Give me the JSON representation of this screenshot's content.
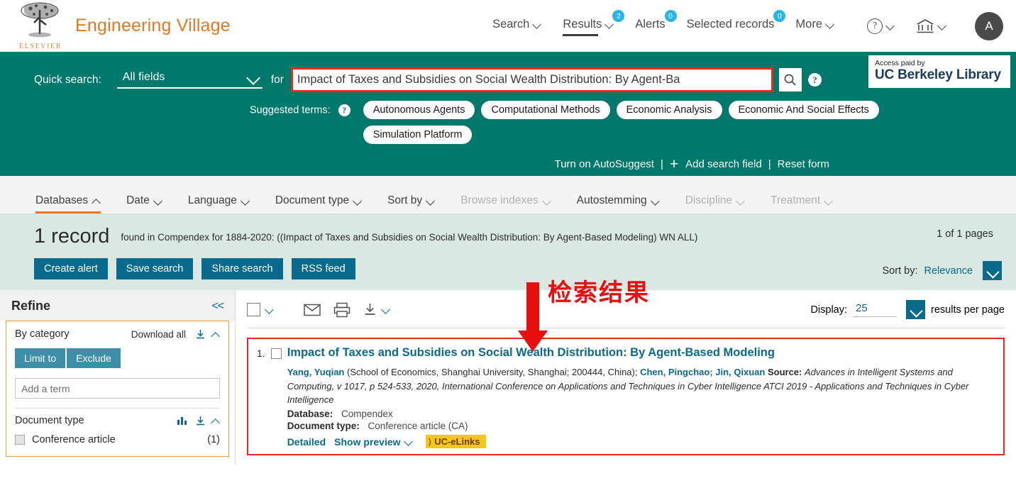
{
  "header": {
    "brand_name": "Engineering Village",
    "publisher": "ELSEVIER",
    "nav": [
      {
        "label": "Search",
        "chevron": true,
        "badge": null,
        "active": false
      },
      {
        "label": "Results",
        "chevron": true,
        "badge": "2",
        "active": true
      },
      {
        "label": "Alerts",
        "chevron": false,
        "badge": "0",
        "active": false
      },
      {
        "label": "Selected records",
        "chevron": false,
        "badge": "0",
        "active": false
      },
      {
        "label": "More",
        "chevron": true,
        "badge": null,
        "active": false
      }
    ],
    "avatar_initial": "A"
  },
  "search": {
    "quick_search_label": "Quick search:",
    "field_value": "All fields",
    "for_label": "for",
    "query": "Impact of Taxes and Subsidies on Social Wealth Distribution: By Agent-Ba",
    "suggested_label": "Suggested terms:",
    "suggested_terms": [
      "Autonomous Agents",
      "Computational Methods",
      "Economic Analysis",
      "Economic And Social Effects",
      "Simulation Platform"
    ],
    "autosuggest": "Turn on AutoSuggest",
    "add_field": "Add search field",
    "reset_form": "Reset form",
    "access_label": "Access paid by",
    "access_org": "UC Berkeley Library"
  },
  "filter_tabs": [
    {
      "label": "Databases",
      "state": "active",
      "chevron": "up"
    },
    {
      "label": "Date",
      "state": "normal",
      "chevron": "down"
    },
    {
      "label": "Language",
      "state": "normal",
      "chevron": "down"
    },
    {
      "label": "Document type",
      "state": "normal",
      "chevron": "down"
    },
    {
      "label": "Sort by",
      "state": "normal",
      "chevron": "down"
    },
    {
      "label": "Browse indexes",
      "state": "disabled",
      "chevron": "down"
    },
    {
      "label": "Autostemming",
      "state": "normal",
      "chevron": "down"
    },
    {
      "label": "Discipline",
      "state": "disabled",
      "chevron": "down"
    },
    {
      "label": "Treatment",
      "state": "disabled",
      "chevron": "down"
    }
  ],
  "summary": {
    "count": "1 record",
    "description": "found in Compendex for 1884-2020: ((Impact of Taxes and Subsidies on Social Wealth Distribution: By Agent-Based Modeling) WN ALL)",
    "pages": "1 of 1 pages",
    "buttons": [
      "Create alert",
      "Save search",
      "Share search",
      "RSS feed"
    ],
    "sort_label": "Sort by:",
    "sort_value": "Relevance"
  },
  "refine": {
    "title": "Refine",
    "collapse": "<<",
    "by_category": "By category",
    "download_all": "Download all",
    "limit_to": "Limit to",
    "exclude": "Exclude",
    "add_term_placeholder": "Add a term",
    "document_type_label": "Document type",
    "facets": [
      {
        "label": "Conference article",
        "count": "(1)"
      }
    ]
  },
  "results_toolbar": {
    "display_label": "Display:",
    "display_value": "25",
    "per_page_label": "results per page"
  },
  "record": {
    "number": "1.",
    "title": "Impact of Taxes and Subsidies on Social Wealth Distribution: By Agent-Based Modeling",
    "author1": "Yang, Yuqian",
    "affiliation": " (School of Economics, Shanghai University, Shanghai; 200444, China); ",
    "author2": "Chen, Pingchao; ",
    "author3": "Jin, Qixuan",
    "source_label": " Source:",
    "source_italic1": "Advances in Intelligent Systems and Computing",
    "source_plain": ", v 1017, p 524-533, 2020, ",
    "source_italic2": "International Conference on Applications and Techniques in Cyber Intelligence ATCI 2019 - Applications and Techniques in Cyber Intelligence",
    "database_key": "Database:",
    "database_value": "Compendex",
    "doctype_key": "Document type:",
    "doctype_value": "Conference article (CA)",
    "detailed": "Detailed",
    "show_preview": "Show preview",
    "uc_elinks": "UC-eLinks"
  },
  "annotation": {
    "text": "检索结果",
    "color": "#e8100f"
  },
  "colors": {
    "brand_orange": "#e87722",
    "teal": "#00786b",
    "blue_button": "#0a6a8e",
    "badge_blue": "#29b4e8",
    "highlight_red": "#e8291c",
    "uc_gold": "#f5c518"
  }
}
